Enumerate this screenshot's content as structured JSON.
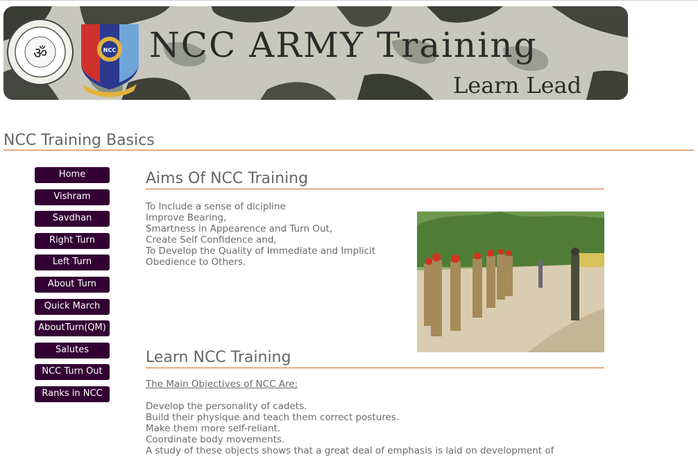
{
  "banner": {
    "title": "NCC ARMY  Training",
    "subtitle": "Learn Lead",
    "college_seal": "college-seal",
    "ncc_crest": "ncc-crest"
  },
  "page": {
    "title": "NCC Training Basics"
  },
  "nav": {
    "items": [
      {
        "label": "Home"
      },
      {
        "label": "Vishram"
      },
      {
        "label": "Savdhan"
      },
      {
        "label": "Right Turn"
      },
      {
        "label": "Left Turn"
      },
      {
        "label": "About Turn"
      },
      {
        "label": "Quick March"
      },
      {
        "label": "AboutTurn(QM)"
      },
      {
        "label": "Salutes"
      },
      {
        "label": "NCC Turn Out"
      },
      {
        "label": "Ranks in NCC"
      }
    ]
  },
  "aims": {
    "title": "Aims Of NCC Training",
    "lines": [
      "To Include a sense of dicipline",
      "Improve Bearing,",
      "Smartness in Appearence and Turn Out,",
      "Create Self Confidence and,",
      "To Develop the Quality of Immediate and Implicit",
      "Obedience to Others."
    ]
  },
  "learn": {
    "title": "Learn NCC Training",
    "objectives_heading": "The Main Objectives of NCC Are:",
    "lines": [
      "Develop the personality of cadets.",
      "Build their physique and teach them correct postures.",
      "Make them more self-reliant.",
      "Coordinate body movements.",
      "A study of these objects shows that a great deal of emphasis is laid on development of"
    ]
  },
  "colors": {
    "nav_bg": "#330033",
    "rule": "#d2691e",
    "text": "#666666"
  }
}
